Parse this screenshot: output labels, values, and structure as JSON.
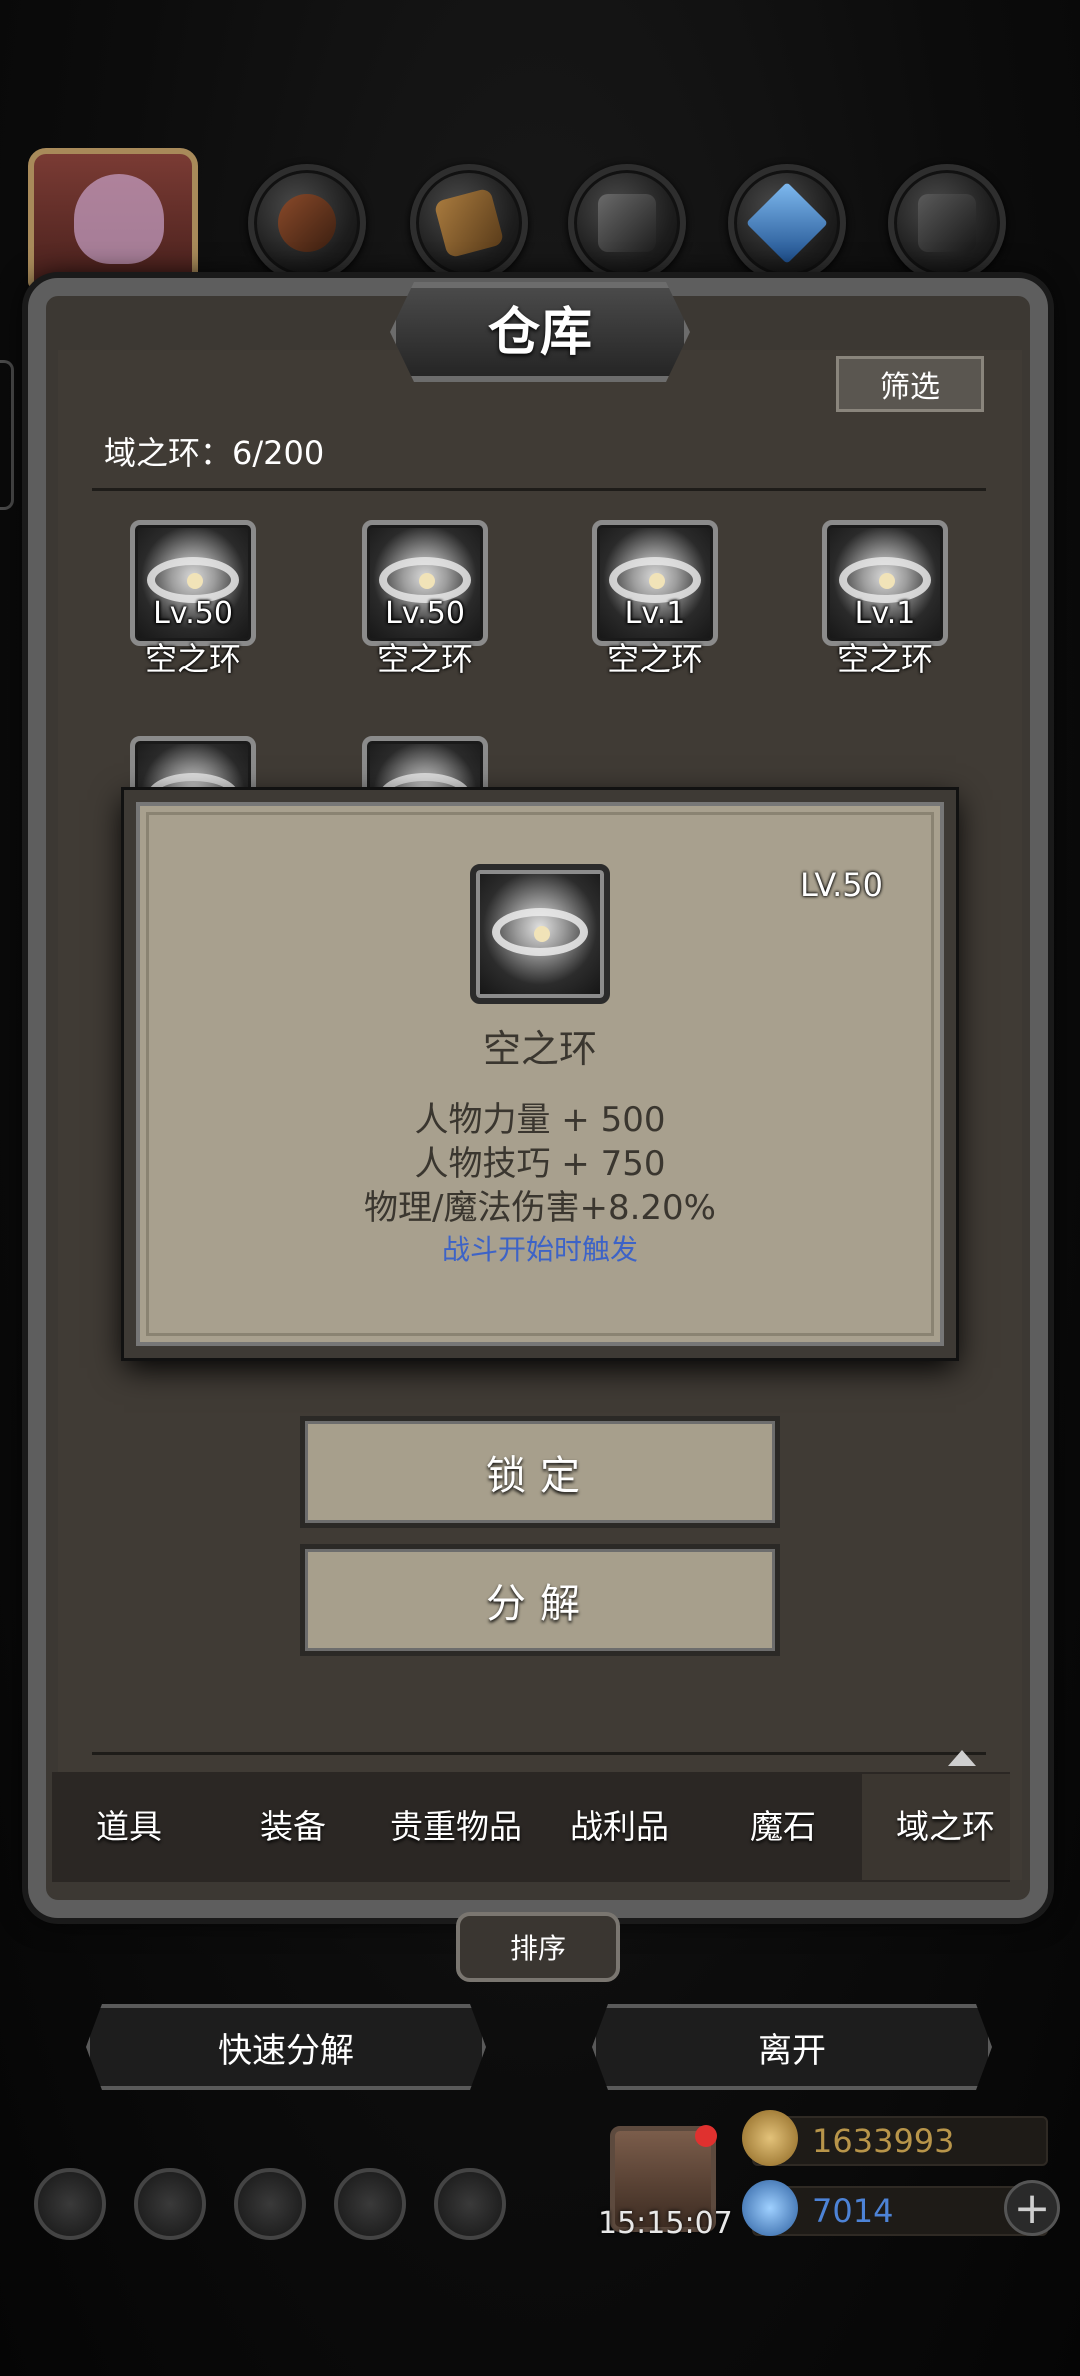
{
  "title": "仓库",
  "filter_label": "筛选",
  "count_label": "域之环：6/200",
  "items": [
    {
      "level": "Lv.50",
      "name": "空之环"
    },
    {
      "level": "Lv.50",
      "name": "空之环"
    },
    {
      "level": "Lv.1",
      "name": "空之环"
    },
    {
      "level": "Lv.1",
      "name": "空之环"
    }
  ],
  "detail": {
    "level": "LV.50",
    "name": "空之环",
    "stats": [
      "人物力量 + 500",
      "人物技巧 + 750",
      "物理/魔法伤害+8.20%"
    ],
    "trigger": "战斗开始时触发",
    "lock_label": "锁定",
    "decompose_label": "分解"
  },
  "tabs": [
    "道具",
    "装备",
    "贵重物品",
    "战利品",
    "魔石",
    "域之环"
  ],
  "active_tab": "域之环",
  "sort_label": "排序",
  "quick_decompose_label": "快速分解",
  "leave_label": "离开",
  "clock": "15:15:07",
  "resources": {
    "gold": "1633993",
    "gems": "7014"
  },
  "colors": {
    "gold_text": "#b8954a",
    "gem_text": "#4d83d6",
    "trigger_text": "#3d63c7"
  }
}
